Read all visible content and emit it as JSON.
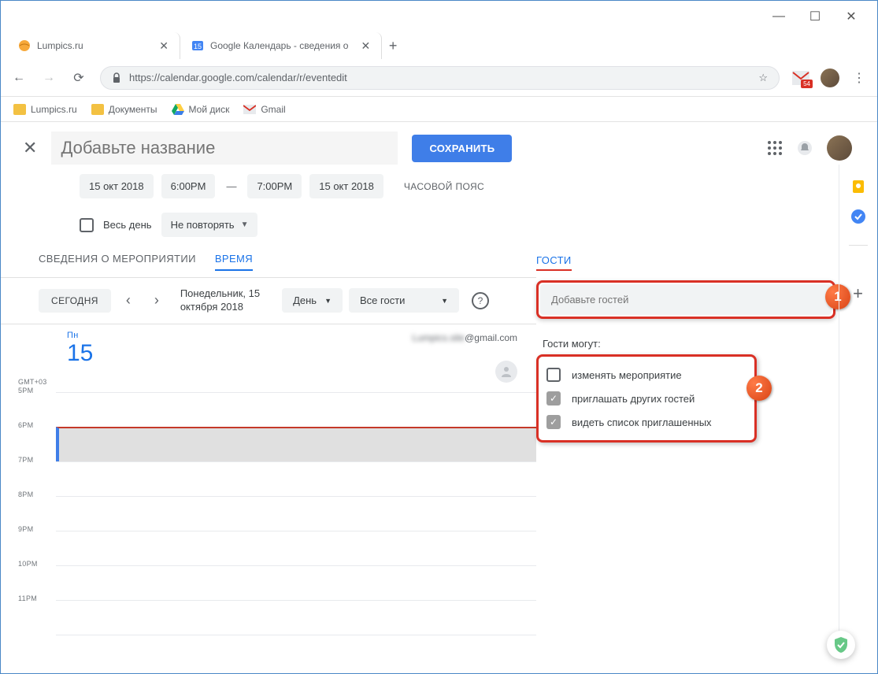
{
  "browser": {
    "tabs": [
      {
        "title": "Lumpics.ru"
      },
      {
        "title": "Google Календарь - сведения о"
      }
    ],
    "url": "https://calendar.google.com/calendar/r/eventedit",
    "gmail_badge": "54",
    "bookmarks": {
      "b1": "Lumpics.ru",
      "b2": "Документы",
      "b3": "Мой диск",
      "b4": "Gmail"
    }
  },
  "event": {
    "title_placeholder": "Добавьте название",
    "save_label": "СОХРАНИТЬ",
    "start_date": "15 окт 2018",
    "start_time": "6:00PM",
    "end_time": "7:00PM",
    "end_date": "15 окт 2018",
    "timezone_link": "ЧАСОВОЙ ПОЯС",
    "all_day_label": "Весь день",
    "repeat_label": "Не повторять"
  },
  "tabs": {
    "details": "СВЕДЕНИЯ О МЕРОПРИЯТИИ",
    "time": "ВРЕМЯ"
  },
  "toolbar": {
    "today": "СЕГОДНЯ",
    "date_line1": "Понедельник, 15",
    "date_line2": "октября 2018",
    "view": "День",
    "guests_filter": "Все гости"
  },
  "day": {
    "weekday": "Пн",
    "num": "15",
    "email_blur": "Lumpics.site",
    "email_vis": "@gmail.com",
    "tz_short": "GMT+03",
    "hours": {
      "h0": "5PM",
      "h1": "6PM",
      "h2": "7PM",
      "h3": "8PM",
      "h4": "9PM",
      "h5": "10PM",
      "h6": "11PM"
    }
  },
  "guests": {
    "heading": "ГОСТИ",
    "input_placeholder": "Добавьте гостей",
    "can_label": "Гости могут:",
    "perm1": "изменять мероприятие",
    "perm2": "приглашать других гостей",
    "perm3": "видеть список приглашенных",
    "badge1": "1",
    "badge2": "2"
  }
}
